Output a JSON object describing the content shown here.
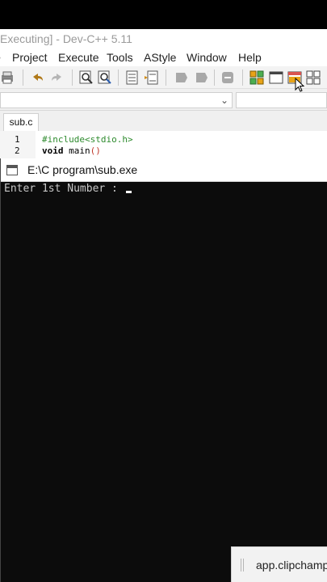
{
  "window": {
    "title": "Executing] - Dev-C++ 5.11"
  },
  "menu": {
    "items": [
      "Project",
      "Execute",
      "Tools",
      "AStyle",
      "Window",
      "Help"
    ]
  },
  "toolbar": {
    "icons": [
      "print-icon",
      "undo-icon",
      "redo-icon",
      "find-icon",
      "replace-icon",
      "indent-icon",
      "unindent-icon",
      "bookmark-icon",
      "bookmark2-icon",
      "goto-icon",
      "new-class-icon",
      "new-window-icon",
      "layout-icon",
      "grid-icon"
    ]
  },
  "editor": {
    "tab": "sub.c",
    "lines": [
      {
        "num": "1",
        "include": "#include<stdio.h>"
      },
      {
        "num": "2",
        "kw": "void",
        "rest": " main",
        "paren": "()"
      }
    ]
  },
  "console": {
    "title": "E:\\C program\\sub.exe",
    "prompt": "Enter 1st Number : "
  },
  "popup": {
    "text": "app.clipchamp"
  },
  "colors": {
    "console_bg": "#0c0c0c",
    "include_green": "#2e8b2e",
    "paren_red": "#c0392b"
  }
}
